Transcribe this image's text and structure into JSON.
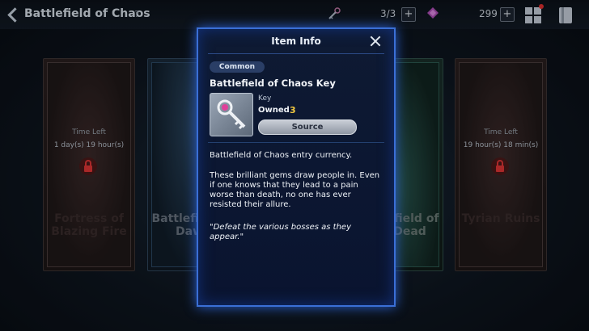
{
  "topbar": {
    "title": "Battlefield of Chaos",
    "help_icon": "?",
    "key_count": "3/3",
    "gem_count": "299",
    "plus": "+"
  },
  "cards": [
    {
      "time_label": "Time Left",
      "time_value": "1 day(s) 19 hour(s)",
      "name": "Fortress of Blazing Fire",
      "locked": true
    },
    {
      "time_label": "",
      "time_value": "",
      "name": "Battlefield of Dawn",
      "locked": false
    },
    {
      "time_label": "",
      "time_value": "",
      "name": "Battlefield of the Dead",
      "locked": false
    },
    {
      "time_label": "Time Left",
      "time_value": "19 hour(s) 18 min(s)",
      "name": "Tyrian Ruins",
      "locked": true
    }
  ],
  "modal": {
    "title": "Item Info",
    "rarity": "Common",
    "item_name": "Battlefield of Chaos Key",
    "item_type": "Key",
    "owned_label": "Owned",
    "owned_value": "3",
    "source_button": "Source",
    "description_1": "Battlefield of Chaos entry currency.",
    "description_2": "These brilliant gems draw people in. Even if one knows that they lead to a pain worse than death, no one has ever resisted their allure.",
    "description_3": "\"Defeat the various bosses as they appear.\""
  },
  "colors": {
    "modal_border": "#3a6fd6",
    "owned_value": "#f2c840",
    "rarity_bg": "#2a3e66"
  }
}
